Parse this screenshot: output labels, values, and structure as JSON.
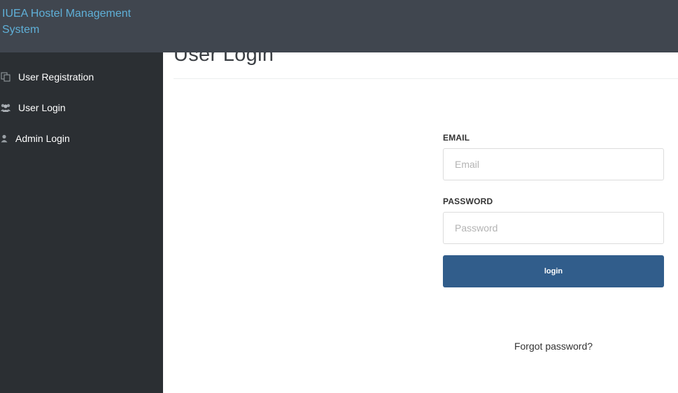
{
  "app": {
    "title": "IUEA Hostel Management System"
  },
  "sidebar": {
    "items": [
      {
        "label": "User Registration",
        "icon": "copy-icon"
      },
      {
        "label": "User Login",
        "icon": "users-icon"
      },
      {
        "label": "Admin Login",
        "icon": "user-icon"
      }
    ]
  },
  "main": {
    "title": "User Login"
  },
  "form": {
    "email_label": "EMAIL",
    "email_placeholder": "Email",
    "password_label": "PASSWORD",
    "password_placeholder": "Password",
    "login_label": "login",
    "forgot_label": "Forgot password?"
  },
  "colors": {
    "topbar": "#40464f",
    "sidebar": "#2b2f33",
    "brand": "#5fb0d8",
    "button": "#315d8b"
  }
}
